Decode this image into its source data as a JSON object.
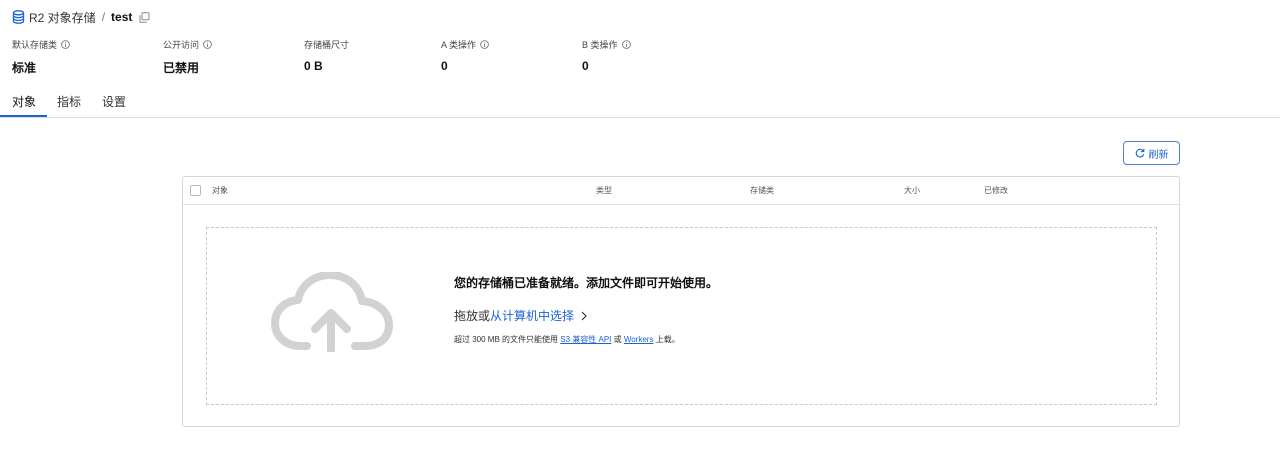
{
  "breadcrumb": {
    "service": "R2 对象存储",
    "separator": "/",
    "bucket": "test"
  },
  "stats": [
    {
      "label": "默认存储类",
      "value": "标准",
      "has_info": true
    },
    {
      "label": "公开访问",
      "value": "已禁用",
      "has_info": true
    },
    {
      "label": "存储桶尺寸",
      "value": "0 B",
      "has_info": false
    },
    {
      "label": "A 类操作",
      "value": "0",
      "has_info": true
    },
    {
      "label": "B 类操作",
      "value": "0",
      "has_info": true
    }
  ],
  "tabs": [
    {
      "label": "对象",
      "active": true
    },
    {
      "label": "指标",
      "active": false
    },
    {
      "label": "设置",
      "active": false
    }
  ],
  "toolbar": {
    "refresh_label": "刷新"
  },
  "table": {
    "columns": [
      "对象",
      "类型",
      "存储类",
      "大小",
      "已修改"
    ]
  },
  "empty_state": {
    "title": "您的存储桶已准备就绪。添加文件即可开始使用。",
    "drag_prefix": "拖放或",
    "select_link": "从计算机中选择",
    "note_prefix": "超过 300 MB 的文件只能使用 ",
    "s3_link": "S3 兼容性 API",
    "note_or": " 或 ",
    "workers_link": "Workers",
    "note_suffix": " 上载。"
  },
  "colors": {
    "accent": "#1d63d6",
    "border": "#d6d6d6",
    "cloud": "#d2d2d2"
  },
  "icons": {
    "breadcrumb": "database-icon",
    "copy": "copy-icon",
    "info": "info-icon",
    "refresh": "refresh-icon",
    "upload": "cloud-upload-icon",
    "chevron": "chevron-right-icon"
  }
}
